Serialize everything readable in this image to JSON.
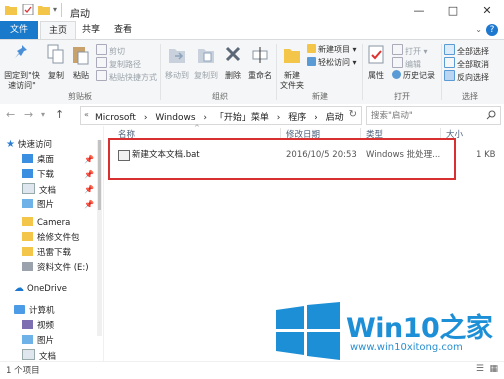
{
  "window": {
    "title": "启动"
  },
  "ribbon": {
    "tabs": {
      "file": "文件",
      "home": "主页",
      "share": "共享",
      "view": "查看"
    },
    "clipboard": {
      "pin_label": "固定到\"快速访问\"",
      "copy": "复制",
      "paste": "粘贴",
      "cut": "剪切",
      "copy_path": "复制路径",
      "paste_shortcut": "粘贴快捷方式",
      "group": "剪贴板"
    },
    "organize": {
      "move_to": "移动到",
      "copy_to": "复制到",
      "delete": "删除",
      "rename": "重命名",
      "group": "组织"
    },
    "new": {
      "new_folder": "新建\n文件夹",
      "new_item": "新建项目 ▾",
      "easy_access": "轻松访问 ▾",
      "group": "新建"
    },
    "open": {
      "properties": "属性",
      "open": "打开 ▾",
      "edit": "编辑",
      "history": "历史记录",
      "group": "打开"
    },
    "select": {
      "select_all": "全部选择",
      "select_none": "全部取消",
      "invert": "反向选择",
      "group": "选择"
    }
  },
  "address": {
    "crumbs": [
      "Microsoft",
      "›",
      "Windows",
      "›",
      "「开始」菜单",
      "›",
      "程序",
      "›",
      "启动"
    ],
    "search_placeholder": "搜索\"启动\""
  },
  "nav": {
    "quick_access": "快速访问",
    "items": [
      "桌面",
      "下载",
      "文档",
      "图片",
      "Camera",
      "桧修文件包",
      "迅雷下载",
      "资料文件 (E:)"
    ],
    "onedrive": "OneDrive",
    "this_pc": "计算机",
    "pc_items": [
      "视频",
      "图片",
      "文档"
    ]
  },
  "content": {
    "columns": {
      "name": "名称",
      "date": "修改日期",
      "type": "类型",
      "size": "大小"
    },
    "files": [
      {
        "name": "新建文本文档.bat",
        "date": "2016/10/5 20:53",
        "type": "Windows 批处理...",
        "size": "1 KB"
      }
    ]
  },
  "status": {
    "count": "1 个项目"
  },
  "watermark": {
    "brand": "Win10之家",
    "url": "www.win10xitong.com"
  },
  "colors": {
    "accent": "#1979ca",
    "highlight": "#d83030",
    "folder": "#f3c64a",
    "watermark": "#1d8fd6"
  }
}
